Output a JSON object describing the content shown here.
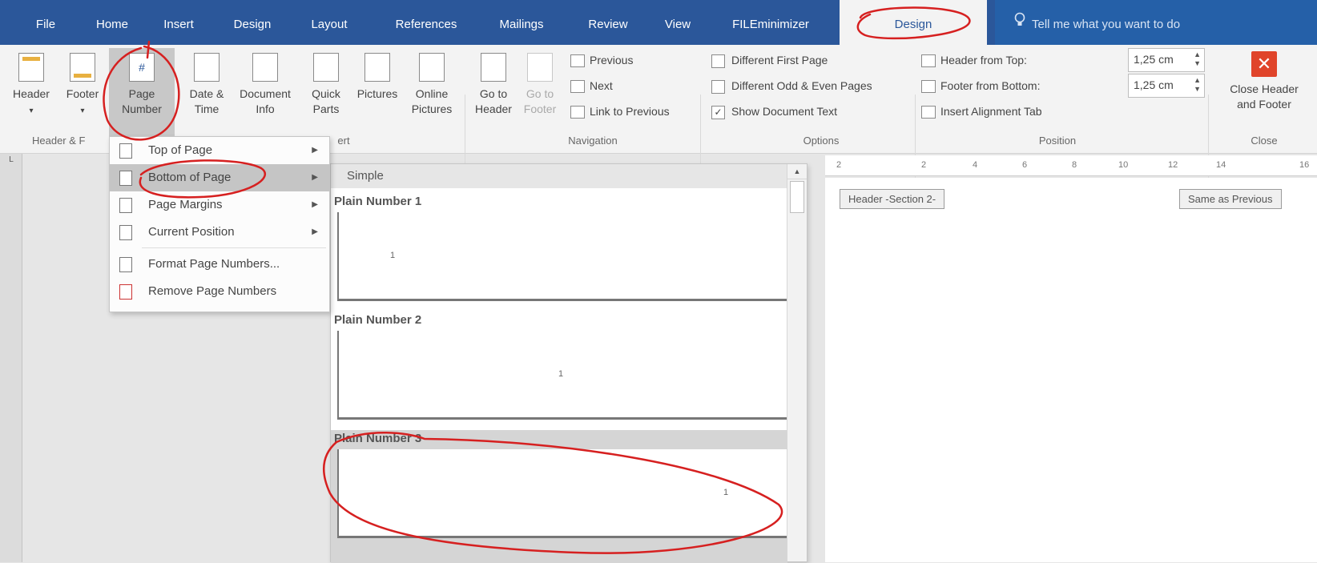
{
  "tabs": [
    "File",
    "Home",
    "Insert",
    "Design",
    "Layout",
    "References",
    "Mailings",
    "Review",
    "View",
    "FILEminimizer",
    "Design"
  ],
  "tell_me": "Tell me what you want to do",
  "ribbon": {
    "header_footer": {
      "header": "Header",
      "footer": "Footer",
      "page_number": "Page Number",
      "group": "Header & F"
    },
    "insert": {
      "date_time": "Date & Time",
      "document_info": "Document Info",
      "quick_parts": "Quick Parts",
      "pictures": "Pictures",
      "online_pictures": "Online Pictures",
      "group": "ert"
    },
    "navigation": {
      "go_to_header": "Go to Header",
      "go_to_footer": "Go to Footer",
      "previous": "Previous",
      "next": "Next",
      "link_to_previous": "Link to Previous",
      "group": "Navigation"
    },
    "options": {
      "different_first": "Different First Page",
      "different_odd_even": "Different Odd & Even Pages",
      "show_doc_text": "Show Document Text",
      "group": "Options"
    },
    "position": {
      "header_from_top": "Header from Top:",
      "header_value": "1,25 cm",
      "footer_from_bottom": "Footer from Bottom:",
      "footer_value": "1,25 cm",
      "insert_alignment_tab": "Insert Alignment Tab",
      "group": "Position"
    },
    "close": {
      "label": "Close Header and Footer",
      "group": "Close"
    }
  },
  "menu": {
    "top_of_page": "Top of Page",
    "bottom_of_page": "Bottom of Page",
    "page_margins": "Page Margins",
    "current_position": "Current Position",
    "format_page_numbers": "Format Page Numbers...",
    "remove_page_numbers": "Remove Page Numbers"
  },
  "gallery": {
    "section": "Simple",
    "items": [
      {
        "label": "Plain Number 1"
      },
      {
        "label": "Plain Number 2"
      },
      {
        "label": "Plain Number 3"
      }
    ],
    "preview_number": "1"
  },
  "document": {
    "header_tag": "Header -Section 2-",
    "same_as_previous": "Same as Previous",
    "ruler_numbers": [
      "2",
      "2",
      "4",
      "6",
      "8",
      "10",
      "12",
      "14",
      "16"
    ]
  },
  "colors": {
    "accent": "#2b579a",
    "annotation": "#d62020",
    "close": "#e0442a"
  }
}
